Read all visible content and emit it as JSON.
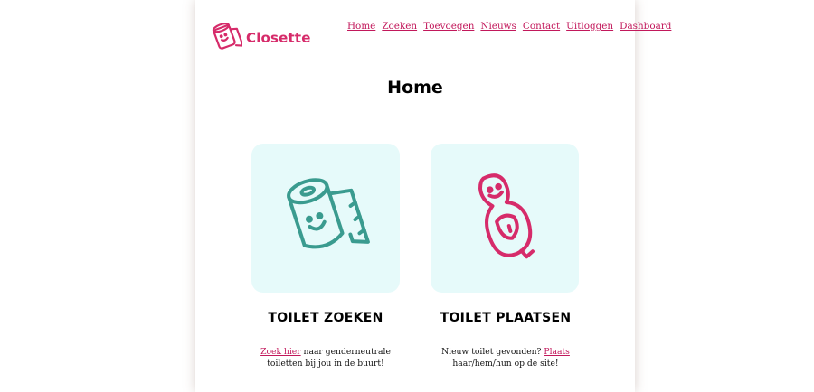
{
  "brand": {
    "name": "Closette",
    "logo_icon": "toilet-roll-icon",
    "color": "#d62b6a"
  },
  "nav": {
    "items": [
      {
        "label": "Home"
      },
      {
        "label": "Zoeken"
      },
      {
        "label": "Toevoegen"
      },
      {
        "label": "Nieuws"
      },
      {
        "label": "Contact"
      },
      {
        "label": "Uitloggen"
      },
      {
        "label": "Dashboard"
      }
    ],
    "link_color": "#c2185b"
  },
  "page": {
    "title": "Home"
  },
  "cards": [
    {
      "icon": "toilet-roll-icon",
      "icon_color": "#3a9b8f",
      "title": "TOILET ZOEKEN",
      "link_text": "Zoek hier",
      "text_after": " naar genderneutrale toiletten bij jou in de buurt!"
    },
    {
      "icon": "toilet-icon",
      "icon_color": "#d62b6a",
      "title": "TOILET PLAATSEN",
      "text_before": "Nieuw toilet gevonden? ",
      "link_text": "Plaats",
      "text_after": " haar/hem/hun op de site!"
    }
  ],
  "card_background": "#e6fafa"
}
